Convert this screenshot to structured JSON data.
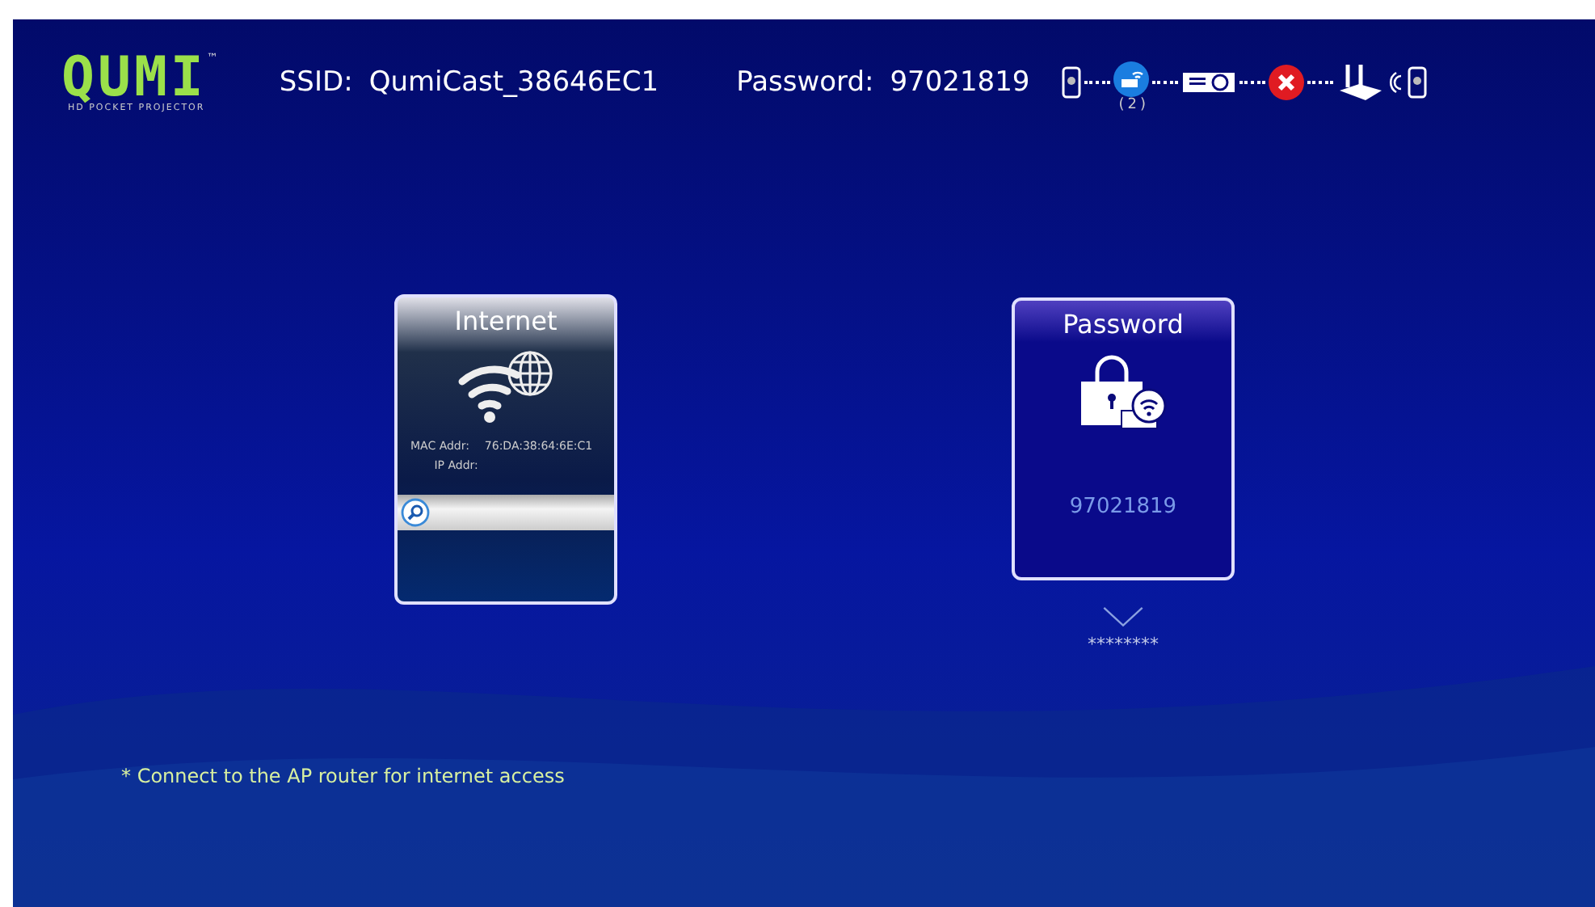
{
  "logo": {
    "wordmark": "QUMI",
    "trademark": "™",
    "tagline": "HD POCKET PROJECTOR"
  },
  "header": {
    "ssid_label": "SSID:",
    "ssid": "QumiCast_38646EC1",
    "password_label": "Password:",
    "password": "97021819"
  },
  "status_chain": {
    "client_count": "(2)",
    "router_connected": false
  },
  "cards": [
    {
      "kind": "internet",
      "title": "Internet",
      "mac_label": "MAC Addr:",
      "mac": "76:DA:38:64:6E:C1",
      "ip_label": "IP Addr:"
    },
    {
      "kind": "password",
      "title": "Password",
      "value": "97021819",
      "masked": "********"
    }
  ],
  "footnote": "* Connect to the AP router for internet access"
}
